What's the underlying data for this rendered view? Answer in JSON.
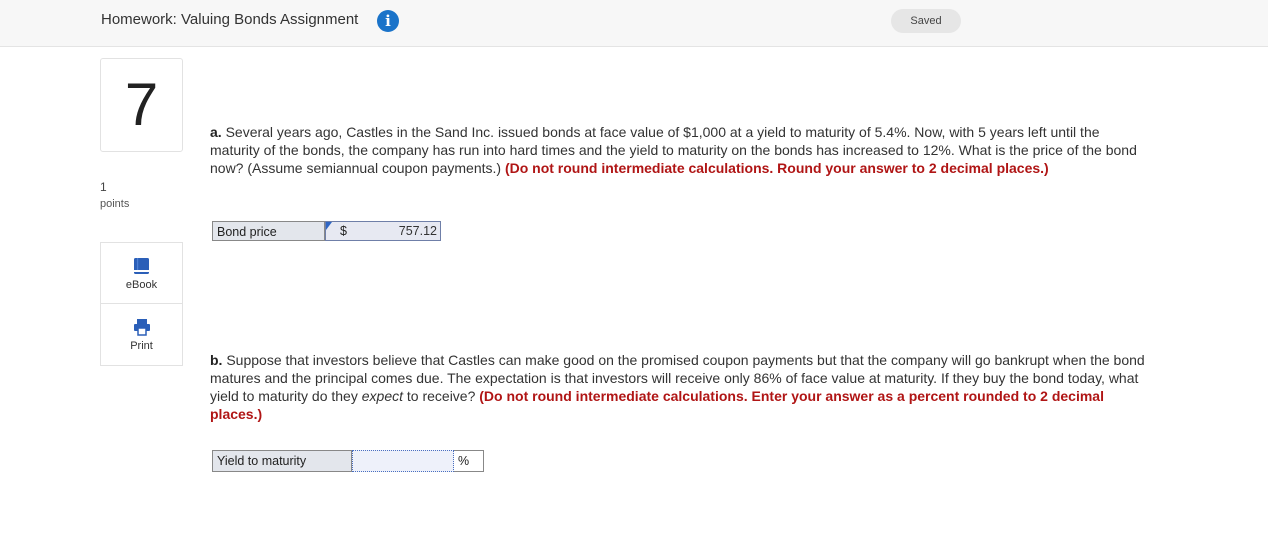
{
  "header": {
    "title": "Homework: Valuing Bonds Assignment",
    "info_icon": "info-icon",
    "saved_status": "Saved"
  },
  "question": {
    "number": "7",
    "points_value": "1",
    "points_label": "points"
  },
  "tools": {
    "ebook_label": "eBook",
    "print_label": "Print"
  },
  "part_a": {
    "prefix": "a.",
    "text": " Several years ago, Castles in the Sand Inc. issued bonds at face value of $1,000 at a yield to maturity of 5.4%. Now, with 5 years left until the maturity of the bonds, the company has run into hard times and the yield to maturity on the bonds has increased to 12%. What is the price of the bond now? (Assume semiannual coupon payments.) ",
    "instruction": "(Do not round intermediate calculations. Round your answer to 2 decimal places.)",
    "answer_label": "Bond price",
    "currency_symbol": "$",
    "answer_value": "757.12"
  },
  "part_b": {
    "prefix": "b.",
    "text_1": " Suppose that investors believe that Castles can make good on the promised coupon payments but that the company will go bankrupt when the bond matures and the principal comes due. The expectation is that investors will receive only 86% of face value at maturity. If they buy the bond today, what yield to maturity do they ",
    "text_em": "expect",
    "text_2": " to receive? ",
    "instruction": "(Do not round intermediate calculations. Enter your answer as a percent rounded to 2 decimal places.)",
    "answer_label": "Yield to maturity",
    "answer_value": "",
    "unit": "%"
  },
  "colors": {
    "accent_blue": "#1a73c9",
    "instruction_red": "#b01515"
  }
}
